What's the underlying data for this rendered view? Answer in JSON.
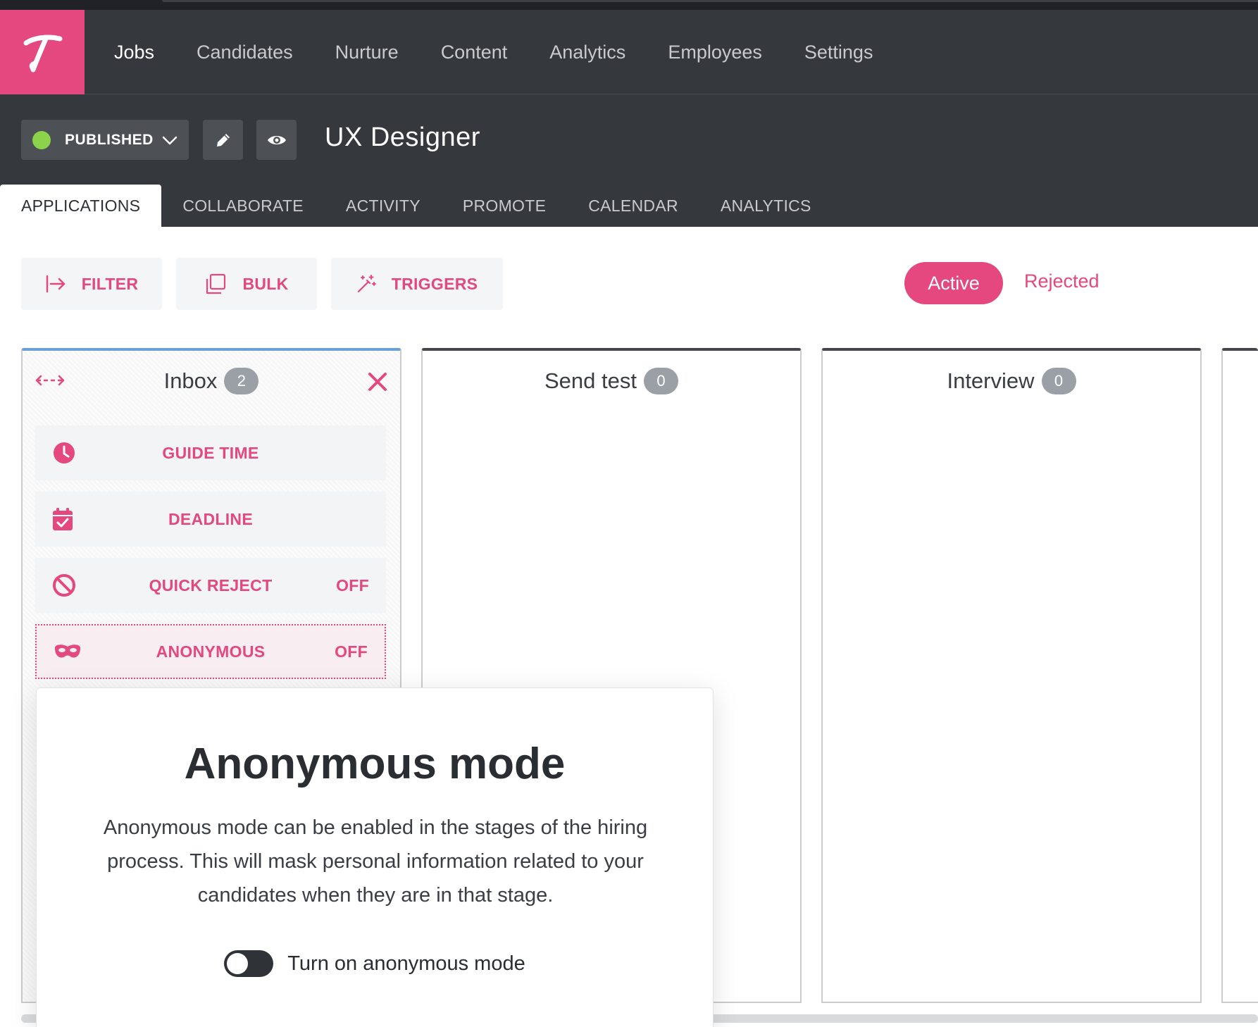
{
  "nav": {
    "logo_icon": "brand-t-logo",
    "items": [
      "Jobs",
      "Candidates",
      "Nurture",
      "Content",
      "Analytics",
      "Employees",
      "Settings"
    ],
    "active": "Jobs"
  },
  "job": {
    "status": "PUBLISHED",
    "title": "UX Designer",
    "icons": [
      "pencil-icon",
      "eye-icon"
    ]
  },
  "tabs": [
    "APPLICATIONS",
    "COLLABORATE",
    "ACTIVITY",
    "PROMOTE",
    "CALENDAR",
    "ANALYTICS"
  ],
  "toolbar": {
    "filter": "FILTER",
    "bulk": "BULK",
    "triggers": "TRIGGERS",
    "active": "Active",
    "rejected": "Rejected"
  },
  "columns": [
    {
      "title": "Inbox",
      "count": "2"
    },
    {
      "title": "Send test",
      "count": "0"
    },
    {
      "title": "Interview",
      "count": "0"
    }
  ],
  "inbox_settings": {
    "guide_time": "GUIDE TIME",
    "deadline": "DEADLINE",
    "quick_reject": "QUICK REJECT",
    "quick_reject_state": "OFF",
    "anonymous": "ANONYMOUS",
    "anonymous_state": "OFF"
  },
  "popover": {
    "title": "Anonymous mode",
    "body": "Anonymous mode can be enabled in the stages of the hiring process. This will mask personal information related to your candidates when they are in that stage.",
    "toggle_label": "Turn on anonymous mode",
    "toggle_on": false
  },
  "colors": {
    "brand": "#e4487f",
    "dark": "#35383d",
    "published": "#8cd24a",
    "inbox_accent": "#6c9fd4"
  }
}
